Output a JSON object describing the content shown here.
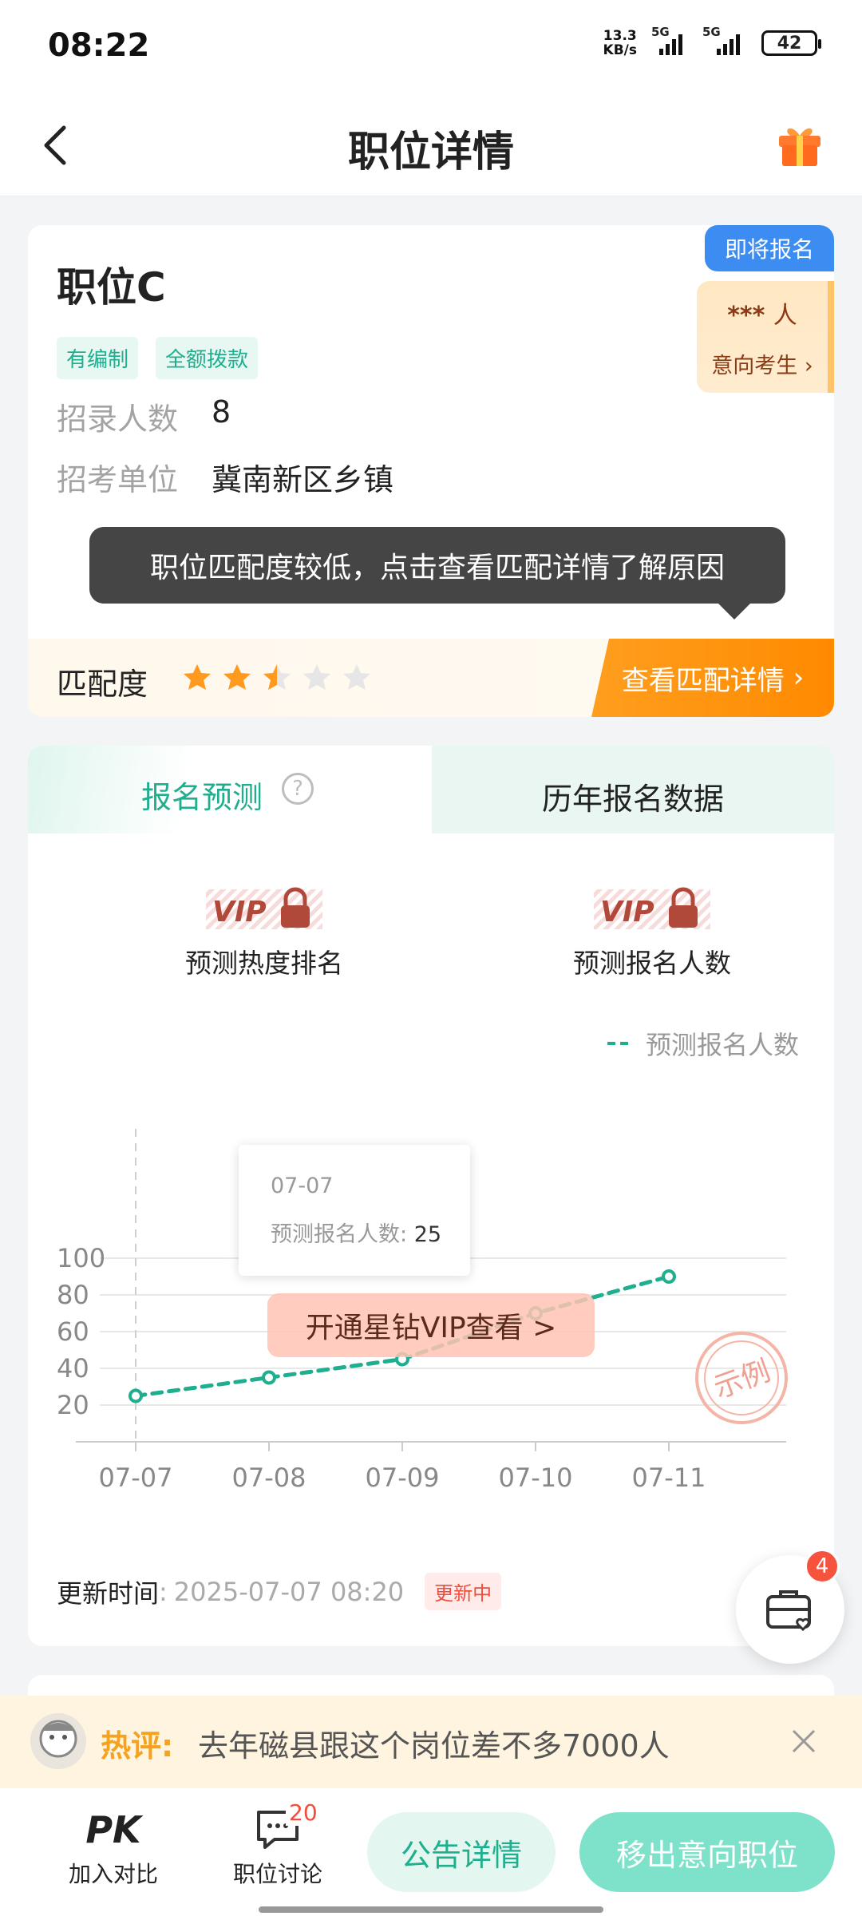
{
  "status_bar": {
    "time": "08:22",
    "net_speed_value": "13.3",
    "net_speed_unit": "KB/s",
    "sim1": "5G",
    "sim2": "5G",
    "battery": "42"
  },
  "nav": {
    "title": "职位详情",
    "back_icon": "chevron-left-icon",
    "gift_icon": "gift-icon"
  },
  "position": {
    "title": "职位C",
    "tags": [
      "有编制",
      "全额拨款"
    ],
    "rows": [
      {
        "key": "招录人数",
        "value": "8"
      },
      {
        "key": "招考单位",
        "value": "冀南新区乡镇"
      }
    ],
    "badge": "即将报名",
    "intent_count_masked": "***",
    "intent_count_unit": "人",
    "intent_link": "意向考生",
    "tooltip": "职位匹配度较低，点击查看匹配详情了解原因",
    "match_label": "匹配度",
    "match_stars": 2.5,
    "match_stars_total": 5,
    "match_button": "查看匹配详情",
    "star_color": "#ff9a1f"
  },
  "prediction": {
    "tabs": [
      {
        "label": "报名预测",
        "active": true
      },
      {
        "label": "历年报名数据",
        "active": false
      }
    ],
    "vip_badge": "VIP",
    "vip_items": [
      "预测热度排名",
      "预测报名人数"
    ],
    "tooltip_date": "07-07",
    "tooltip_label": "预测报名人数",
    "tooltip_value": "25",
    "vip_open_button": "开通星钻VIP查看 >",
    "stamp_text": "示例",
    "update_label": "更新时间",
    "update_time": "2025-07-07 08:20",
    "update_status": "更新中"
  },
  "chart_data": {
    "type": "line",
    "categories": [
      "07-07",
      "07-08",
      "07-09",
      "07-10",
      "07-11"
    ],
    "series": [
      {
        "name": "预测报名人数",
        "values": [
          25,
          35,
          45,
          70,
          90
        ],
        "color": "#1fae8e"
      }
    ],
    "y_ticks": [
      20,
      40,
      60,
      80,
      100
    ],
    "ylim": [
      0,
      100
    ],
    "grid": true,
    "legend": "top-right",
    "title": "",
    "xlabel": "",
    "ylabel": ""
  },
  "floating": {
    "icon": "briefcase-heart-icon",
    "badge": "4"
  },
  "hot_comment": {
    "label": "热评:",
    "text": "去年磁县跟这个岗位差不多7000人"
  },
  "bottom_bar": {
    "compare_icon": "PK",
    "compare_label": "加入对比",
    "discuss_label": "职位讨论",
    "discuss_badge": "20",
    "notice_button": "公告详情",
    "remove_button": "移出意向职位"
  }
}
